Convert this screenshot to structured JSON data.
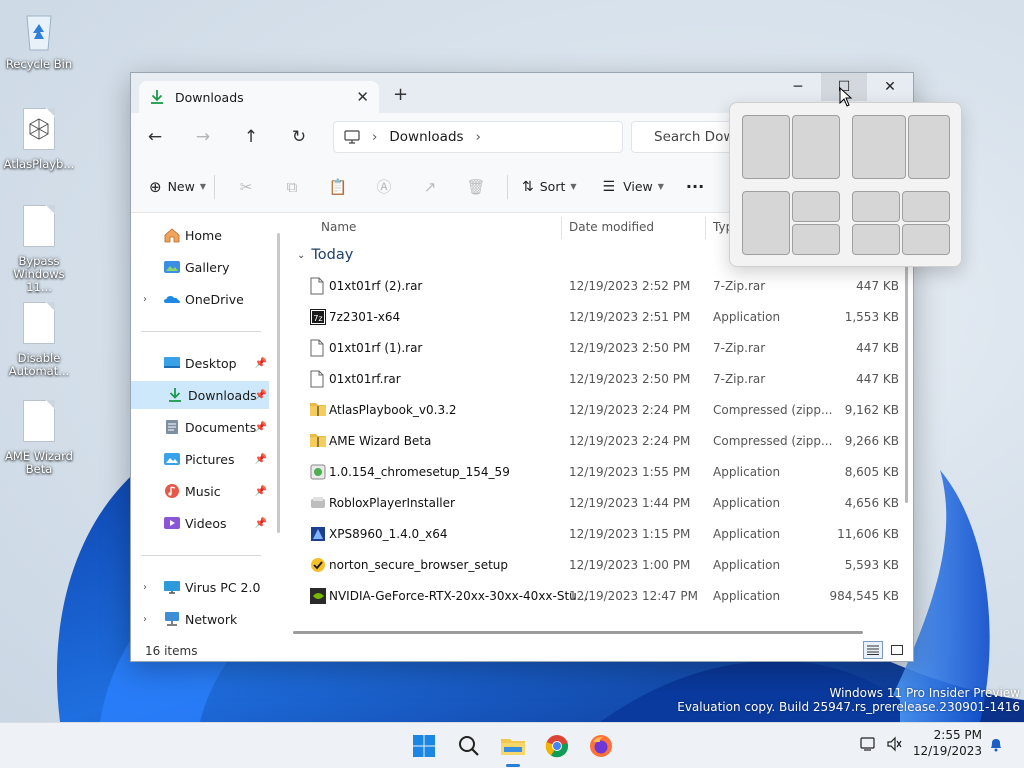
{
  "desktop": {
    "icons": [
      {
        "label": "Recycle Bin"
      },
      {
        "label": "AtlasPlayb..."
      },
      {
        "label": "Bypass Windows 11..."
      },
      {
        "label": "Disable Automat..."
      },
      {
        "label": "AME Wizard Beta"
      }
    ],
    "watermark": {
      "line1": "Windows 11 Pro Insider Preview",
      "line2": "Evaluation copy. Build 25947.rs_prerelease.230901-1416"
    }
  },
  "window": {
    "tab_title": "Downloads",
    "address": {
      "segment": "Downloads"
    },
    "search_placeholder": "Search Downloads",
    "toolbar": {
      "new_label": "New",
      "sort_label": "Sort",
      "view_label": "View"
    },
    "nav": {
      "items": [
        {
          "label": "Home",
          "icon": "home-icon"
        },
        {
          "label": "Gallery",
          "icon": "gallery-icon"
        },
        {
          "label": "OneDrive",
          "icon": "onedrive-icon"
        },
        {
          "label": "Desktop",
          "icon": "desktop-icon"
        },
        {
          "label": "Downloads",
          "icon": "downloads-icon"
        },
        {
          "label": "Documents",
          "icon": "documents-icon"
        },
        {
          "label": "Pictures",
          "icon": "pictures-icon"
        },
        {
          "label": "Music",
          "icon": "music-icon"
        },
        {
          "label": "Videos",
          "icon": "videos-icon"
        },
        {
          "label": "Virus PC 2.0",
          "icon": "computer-icon"
        },
        {
          "label": "Network",
          "icon": "network-icon"
        }
      ]
    },
    "columns": {
      "name": "Name",
      "date": "Date modified",
      "type": "Typ"
    },
    "group_label": "Today",
    "files": [
      {
        "name": "01xt01rf (2).rar",
        "date": "12/19/2023 2:52 PM",
        "type": "7-Zip.rar",
        "size": "447 KB",
        "icon": "file-icon"
      },
      {
        "name": "7z2301-x64",
        "date": "12/19/2023 2:51 PM",
        "type": "Application",
        "size": "1,553 KB",
        "icon": "7zip-icon"
      },
      {
        "name": "01xt01rf (1).rar",
        "date": "12/19/2023 2:50 PM",
        "type": "7-Zip.rar",
        "size": "447 KB",
        "icon": "file-icon"
      },
      {
        "name": "01xt01rf.rar",
        "date": "12/19/2023 2:50 PM",
        "type": "7-Zip.rar",
        "size": "447 KB",
        "icon": "file-icon"
      },
      {
        "name": "AtlasPlaybook_v0.3.2",
        "date": "12/19/2023 2:24 PM",
        "type": "Compressed (zipp...",
        "size": "9,162 KB",
        "icon": "zip-folder-icon"
      },
      {
        "name": "AME Wizard Beta",
        "date": "12/19/2023 2:24 PM",
        "type": "Compressed (zipp...",
        "size": "9,266 KB",
        "icon": "zip-folder-icon"
      },
      {
        "name": "1.0.154_chromesetup_154_59",
        "date": "12/19/2023 1:55 PM",
        "type": "Application",
        "size": "8,605 KB",
        "icon": "installer-icon"
      },
      {
        "name": "RobloxPlayerInstaller",
        "date": "12/19/2023 1:44 PM",
        "type": "Application",
        "size": "4,656 KB",
        "icon": "roblox-icon"
      },
      {
        "name": "XPS8960_1.4.0_x64",
        "date": "12/19/2023 1:15 PM",
        "type": "Application",
        "size": "11,606 KB",
        "icon": "setup-icon"
      },
      {
        "name": "norton_secure_browser_setup",
        "date": "12/19/2023 1:00 PM",
        "type": "Application",
        "size": "5,593 KB",
        "icon": "norton-icon"
      },
      {
        "name": "NVIDIA-GeForce-RTX-20xx-30xx-40xx-Stu...",
        "date": "12/19/2023 12:47 PM",
        "type": "Application",
        "size": "984,545 KB",
        "icon": "nvidia-icon"
      }
    ],
    "status": "16 items"
  },
  "taskbar": {
    "time": "2:55 PM",
    "date": "12/19/2023"
  },
  "colors": {
    "accent": "#2a7fd4",
    "selected": "#cde8fa",
    "folder": "#f2c94c"
  }
}
